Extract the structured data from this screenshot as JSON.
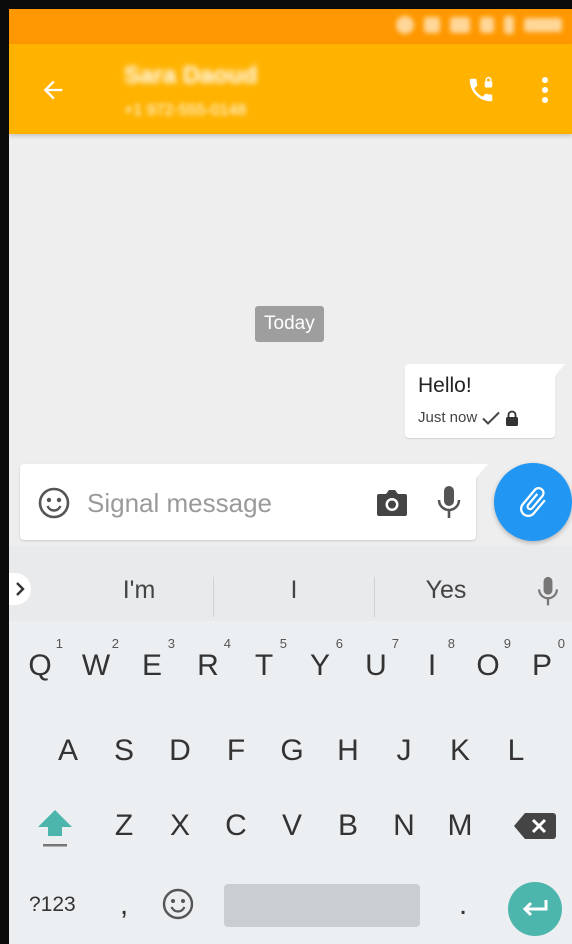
{
  "colors": {
    "status_bar": "#ff9800",
    "toolbar": "#ffb300",
    "background": "#eeeeee",
    "date_chip": "#9e9e9e",
    "fab": "#2196f3",
    "enter_key": "#4db6ac",
    "shift_key": "#4db6ac"
  },
  "toolbar": {
    "contact_name": "Sara Daoud",
    "contact_number": "+1 972-555-0148",
    "back_icon": "arrow-left-icon",
    "call_icon": "secure-call-icon",
    "menu_icon": "more-vert-icon"
  },
  "conversation": {
    "date_divider": "Today",
    "messages": [
      {
        "text": "Hello!",
        "time": "Just now",
        "status_icon": "check-icon",
        "secure_icon": "lock-icon"
      }
    ]
  },
  "compose": {
    "placeholder": "Signal message",
    "emoji_icon": "emoji-icon",
    "camera_icon": "camera-icon",
    "mic_icon": "mic-icon",
    "attach_icon": "paperclip-icon"
  },
  "keyboard": {
    "suggestions": [
      "I'm",
      "I",
      "Yes"
    ],
    "row1": [
      {
        "key": "Q",
        "hint": "1"
      },
      {
        "key": "W",
        "hint": "2"
      },
      {
        "key": "E",
        "hint": "3"
      },
      {
        "key": "R",
        "hint": "4"
      },
      {
        "key": "T",
        "hint": "5"
      },
      {
        "key": "Y",
        "hint": "6"
      },
      {
        "key": "U",
        "hint": "7"
      },
      {
        "key": "I",
        "hint": "8"
      },
      {
        "key": "O",
        "hint": "9"
      },
      {
        "key": "P",
        "hint": "0"
      }
    ],
    "row2": [
      "A",
      "S",
      "D",
      "F",
      "G",
      "H",
      "J",
      "K",
      "L"
    ],
    "row3": [
      "Z",
      "X",
      "C",
      "V",
      "B",
      "N",
      "M"
    ],
    "symbols_label": "?123",
    "comma": ",",
    "period": "."
  }
}
